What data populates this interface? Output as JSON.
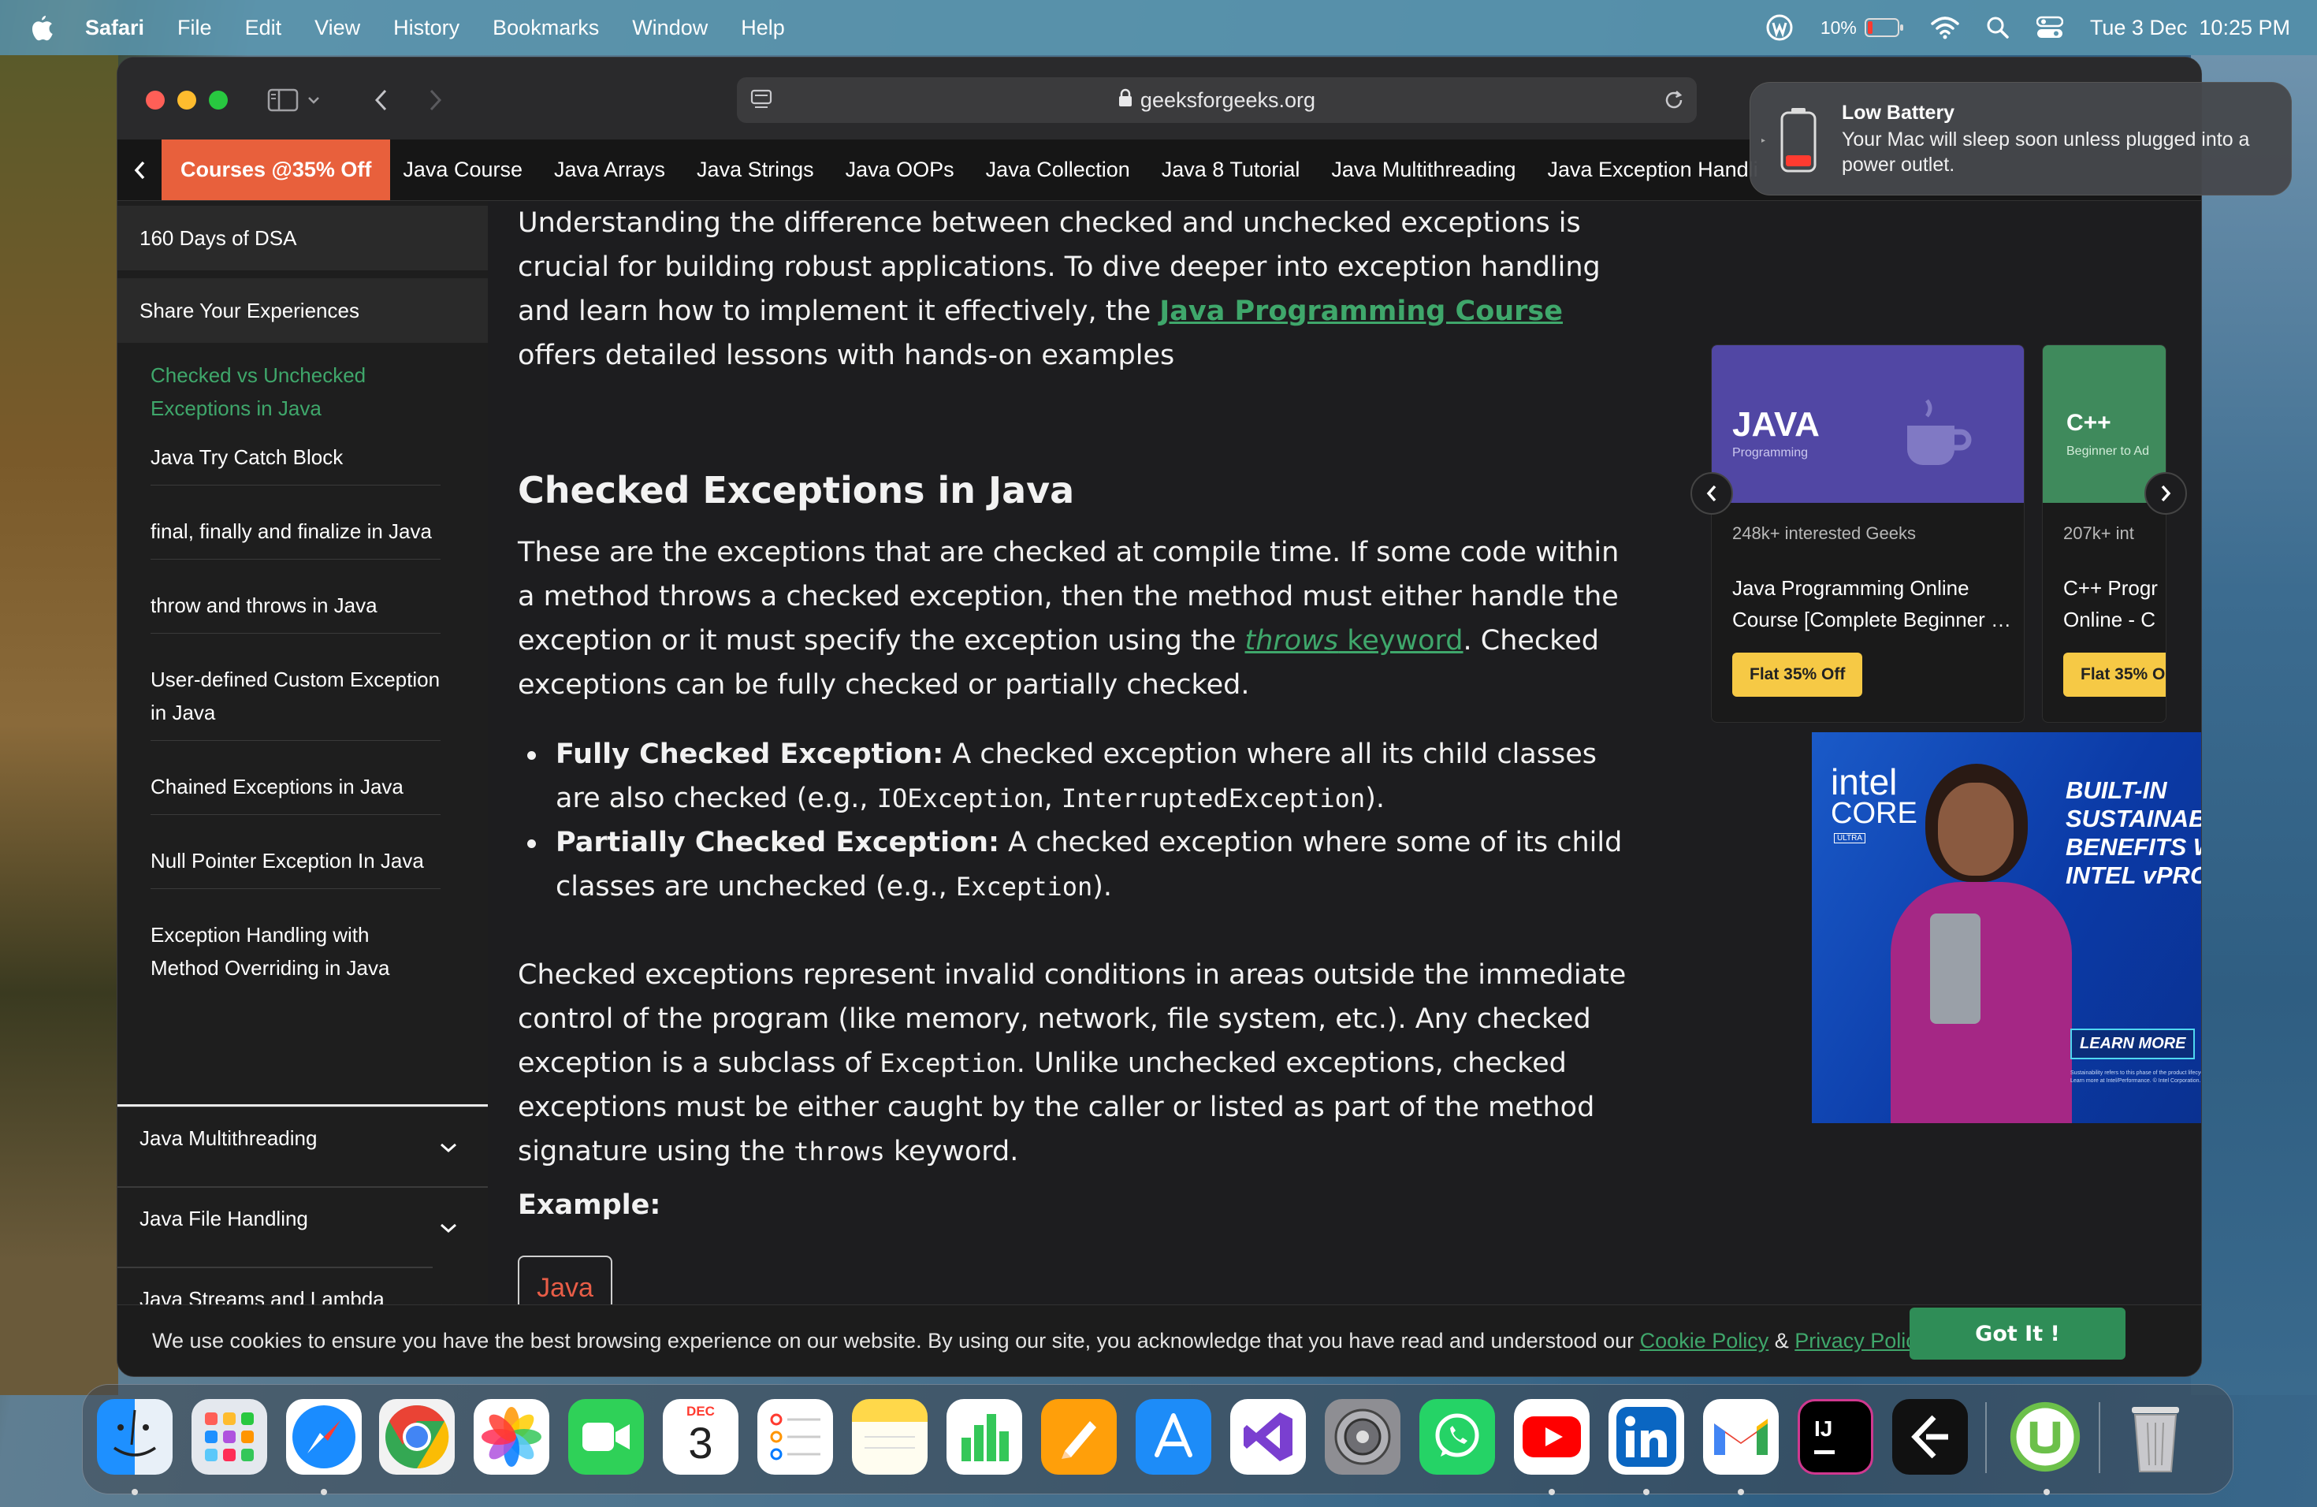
{
  "menubar": {
    "app": "Safari",
    "items": [
      "File",
      "Edit",
      "View",
      "History",
      "Bookmarks",
      "Window",
      "Help"
    ],
    "battery_pct": "10%",
    "datetime": "Tue 3 Dec  10:25 PM"
  },
  "browser": {
    "url": "geeksforgeeks.org"
  },
  "notification": {
    "title": "Low Battery",
    "body": "Your Mac will sleep soon unless plugged into a power outlet."
  },
  "catnav": {
    "promo": "Courses @35% Off",
    "items": [
      "Java Course",
      "Java Arrays",
      "Java Strings",
      "Java OOPs",
      "Java Collection",
      "Java 8 Tutorial",
      "Java Multithreading",
      "Java Exception Handli"
    ]
  },
  "sidebar": {
    "blocks": [
      "160 Days of DSA",
      "Share Your Experiences"
    ],
    "active": "Checked vs Unchecked Exceptions in Java",
    "items": [
      "Java Try Catch Block",
      "final, finally and finalize in Java",
      "throw and throws in Java",
      "User-defined Custom Exception in Java",
      "Chained Exceptions in Java",
      "Null Pointer Exception In Java",
      "Exception Handling with Method Overriding in Java"
    ],
    "sections": [
      "Java Multithreading",
      "Java File Handling",
      "Java Streams and Lambda Expressions"
    ]
  },
  "article": {
    "intro_a": "Understanding the difference between checked and unchecked exceptions is crucial for building robust applications. To dive deeper into exception handling and learn how to implement it effectively, the ",
    "intro_link": "Java Programming Course",
    "intro_b": " offers detailed lessons with hands-on examples",
    "heading": "Checked Exceptions in Java",
    "p2_a": "These are the exceptions that are checked at compile time. If some code within a method throws a checked exception, then the method must either handle the exception or it must specify the exception using the ",
    "p2_link_em": "throws",
    "p2_link": " keyword",
    "p2_b": ". Checked exceptions can be fully checked or partially checked.",
    "b1_bold": "Fully Checked Exception:",
    "b1_a": " A checked exception where all its child classes are also checked (e.g., ",
    "b1_code1": "IOException",
    "b1_sep": ", ",
    "b1_code2": "InterruptedException",
    "b1_end": ").",
    "b2_bold": "Partially Checked Exception:",
    "b2_a": " A checked exception where some of its child classes are unchecked (e.g., ",
    "b2_code": "Exception",
    "b2_end": ").",
    "p3_a": "Checked exceptions represent invalid conditions in areas outside the immediate control of the program (like memory, network, file system, etc.). Any checked exception is a subclass of ",
    "p3_code1": "Exception",
    "p3_b": ". Unlike unchecked exceptions, checked exceptions must be either caught by the caller or listed as part of the method signature using the ",
    "p3_code2": "throws",
    "p3_c": " keyword.",
    "example_label": "Example:",
    "code_tab": "Java"
  },
  "courses": [
    {
      "banner_title": "JAVA",
      "banner_sub": "Programming",
      "geeks": "248k+ interested Geeks",
      "title_line1": "Java Programming Online",
      "title_line2": "Course [Complete Beginner …",
      "button": "Flat 35% Off"
    },
    {
      "banner_title": "C++",
      "banner_sub": "Beginner to Ad",
      "geeks": "207k+ int",
      "title_line1": "C++ Progr",
      "title_line2": "Online - C",
      "button": "Flat 35% O"
    }
  ],
  "ad": {
    "brand1": "intel",
    "brand2": "CORE",
    "brand3": "ULTRA",
    "headline": "BUILT-IN SUSTAINABILITY BENEFITS WITH INTEL vPRO",
    "cta": "LEARN MORE",
    "fineprint": "Sustainability refers to this phase of the product lifecycle. Results may vary. Learn more at Intel/Performance. © Intel Corporation."
  },
  "cookie": {
    "text": "We use cookies to ensure you have the best browsing experience on our website. By using our site, you acknowledge that you have read and understood our ",
    "link1": "Cookie Policy",
    "amp": " & ",
    "link2": "Privacy Policy",
    "button": "Got It !"
  },
  "dock": {
    "calendar_month": "DEC",
    "calendar_day": "3",
    "apps": [
      "Finder",
      "Launchpad",
      "Safari",
      "Google Chrome",
      "Photos",
      "FaceTime",
      "Calendar",
      "Reminders",
      "Notes",
      "Numbers",
      "Pages",
      "App Store",
      "Visual Studio",
      "System Settings",
      "WhatsApp",
      "YouTube",
      "LinkedIn",
      "Gmail",
      "IntelliJ IDEA",
      "Proxyman",
      "uTorrent",
      "Trash"
    ]
  }
}
